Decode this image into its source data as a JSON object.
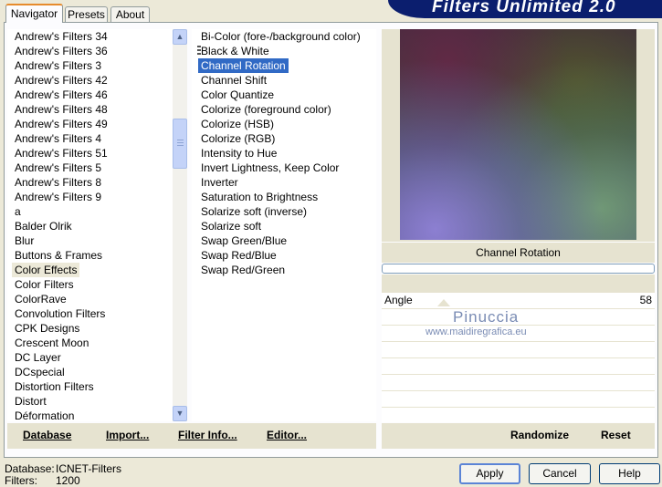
{
  "app_title": "Filters Unlimited 2.0",
  "tabs": [
    {
      "label": "Navigator",
      "active": true
    },
    {
      "label": "Presets",
      "active": false
    },
    {
      "label": "About",
      "active": false
    }
  ],
  "categories": [
    "Andrew's Filters 34",
    "Andrew's Filters 36",
    "Andrew's Filters 3",
    "Andrew's Filters 42",
    "Andrew's Filters 46",
    "Andrew's Filters 48",
    "Andrew's Filters 49",
    "Andrew's Filters 4",
    "Andrew's Filters 51",
    "Andrew's Filters 5",
    "Andrew's Filters 8",
    "Andrew's Filters 9",
    "a",
    "Balder Olrik",
    "Blur",
    "Buttons & Frames",
    "Color Effects",
    "Color Filters",
    "ColorRave",
    "Convolution Filters",
    "CPK Designs",
    "Crescent Moon",
    "DC Layer",
    "DCspecial",
    "Distortion Filters",
    "Distort",
    "Déformation"
  ],
  "selected_category": "Color Effects",
  "filters": [
    "Bi-Color (fore-/background color)",
    "Black & White",
    "Channel Rotation",
    "Channel Shift",
    "Color Quantize",
    "Colorize (foreground color)",
    "Colorize (HSB)",
    "Colorize (RGB)",
    "Intensity to Hue",
    "Invert Lightness, Keep Color",
    "Inverter",
    "Saturation to Brightness",
    "Solarize soft (inverse)",
    "Solarize soft",
    "Swap Green/Blue",
    "Swap Red/Blue",
    "Swap Red/Green"
  ],
  "selected_filter": "Channel Rotation",
  "left_commands": {
    "database": "Database",
    "import": "Import...",
    "filter_info": "Filter Info...",
    "editor": "Editor..."
  },
  "right_commands": {
    "randomize": "Randomize",
    "reset": "Reset"
  },
  "preview_filter_name": "Channel Rotation",
  "control": {
    "label": "Angle",
    "value": "58"
  },
  "watermark": {
    "name": "Pinuccia",
    "url": "www.maidiregrafica.eu"
  },
  "status": {
    "database_label": "Database:",
    "database_value": "ICNET-Filters",
    "filters_label": "Filters:",
    "filters_value": "1200"
  },
  "buttons": {
    "apply": "Apply",
    "cancel": "Cancel",
    "help": "Help"
  },
  "icons": {
    "scroll_up": "scroll-up-arrow-icon",
    "scroll_down": "scroll-down-arrow-icon"
  }
}
